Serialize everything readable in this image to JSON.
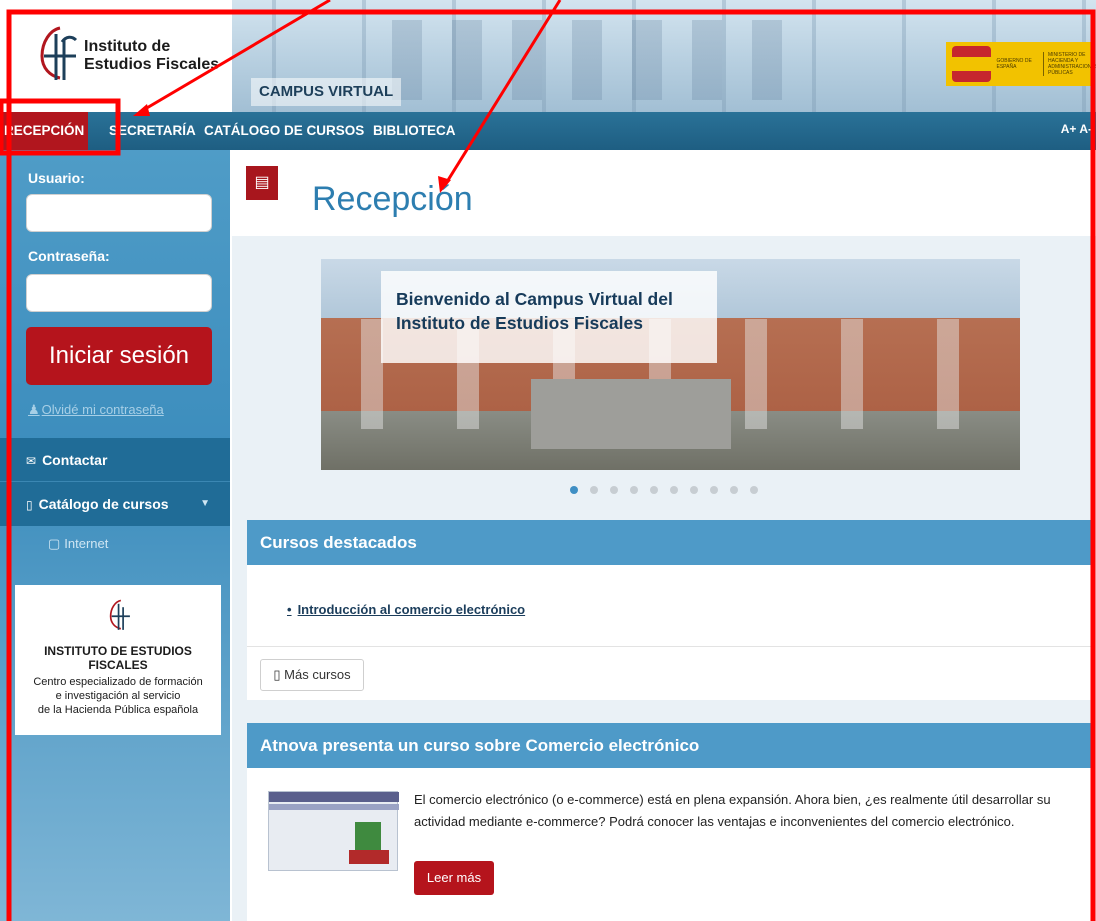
{
  "header": {
    "logo_line1": "Instituto de",
    "logo_line2": "Estudios Fiscales",
    "banner_label": "CAMPUS VIRTUAL",
    "gov_text1": "GOBIERNO DE ESPAÑA",
    "gov_text2": "MINISTERIO DE HACIENDA Y ADMINISTRACIONES PÚBLICAS"
  },
  "topnav": {
    "items": [
      "RECEPCIÓN",
      "SECRETARÍA",
      "CATÁLOGO DE CURSOS",
      "BIBLIOTECA"
    ],
    "font_size": "A+ A-"
  },
  "sidebar": {
    "user_label": "Usuario:",
    "password_label": "Contraseña:",
    "login_button": "Iniciar sesión",
    "forgot_link": "Olvidé mi contraseña",
    "contact": "Contactar",
    "catalog": "Catálogo de cursos",
    "catalog_sub": "Internet",
    "card_title": "INSTITUTO DE ESTUDIOS FISCALES",
    "card_desc1": "Centro especializado de formación",
    "card_desc2": "e investigación al servicio",
    "card_desc3": "de la Hacienda Pública española"
  },
  "main": {
    "page_title": "Recepción",
    "carousel_caption_line1": "Bienvenido al Campus Virtual del",
    "carousel_caption_line2": "Instituto de Estudios Fiscales",
    "carousel_slide_count": 10,
    "carousel_active_slide": 1,
    "featured": {
      "title": "Cursos destacados",
      "course": "Introducción al comercio electrónico",
      "more_button": "Más cursos"
    },
    "article": {
      "title": "Atnova presenta un curso sobre Comercio electrónico",
      "text": "El comercio electrónico (o e-commerce) está en plena expansión. Ahora bien, ¿es realmente útil desarrollar su actividad mediante e-commerce? Podrá conocer las ventajas e inconvenientes del comercio electrónico.",
      "read_more": "Leer más"
    }
  },
  "colors": {
    "brand_red": "#b5141c",
    "nav_blue": "#1e5e82",
    "panel_blue": "#4e9ac8",
    "title_blue": "#2d7eb0",
    "annotation_red": "#ff0000"
  }
}
